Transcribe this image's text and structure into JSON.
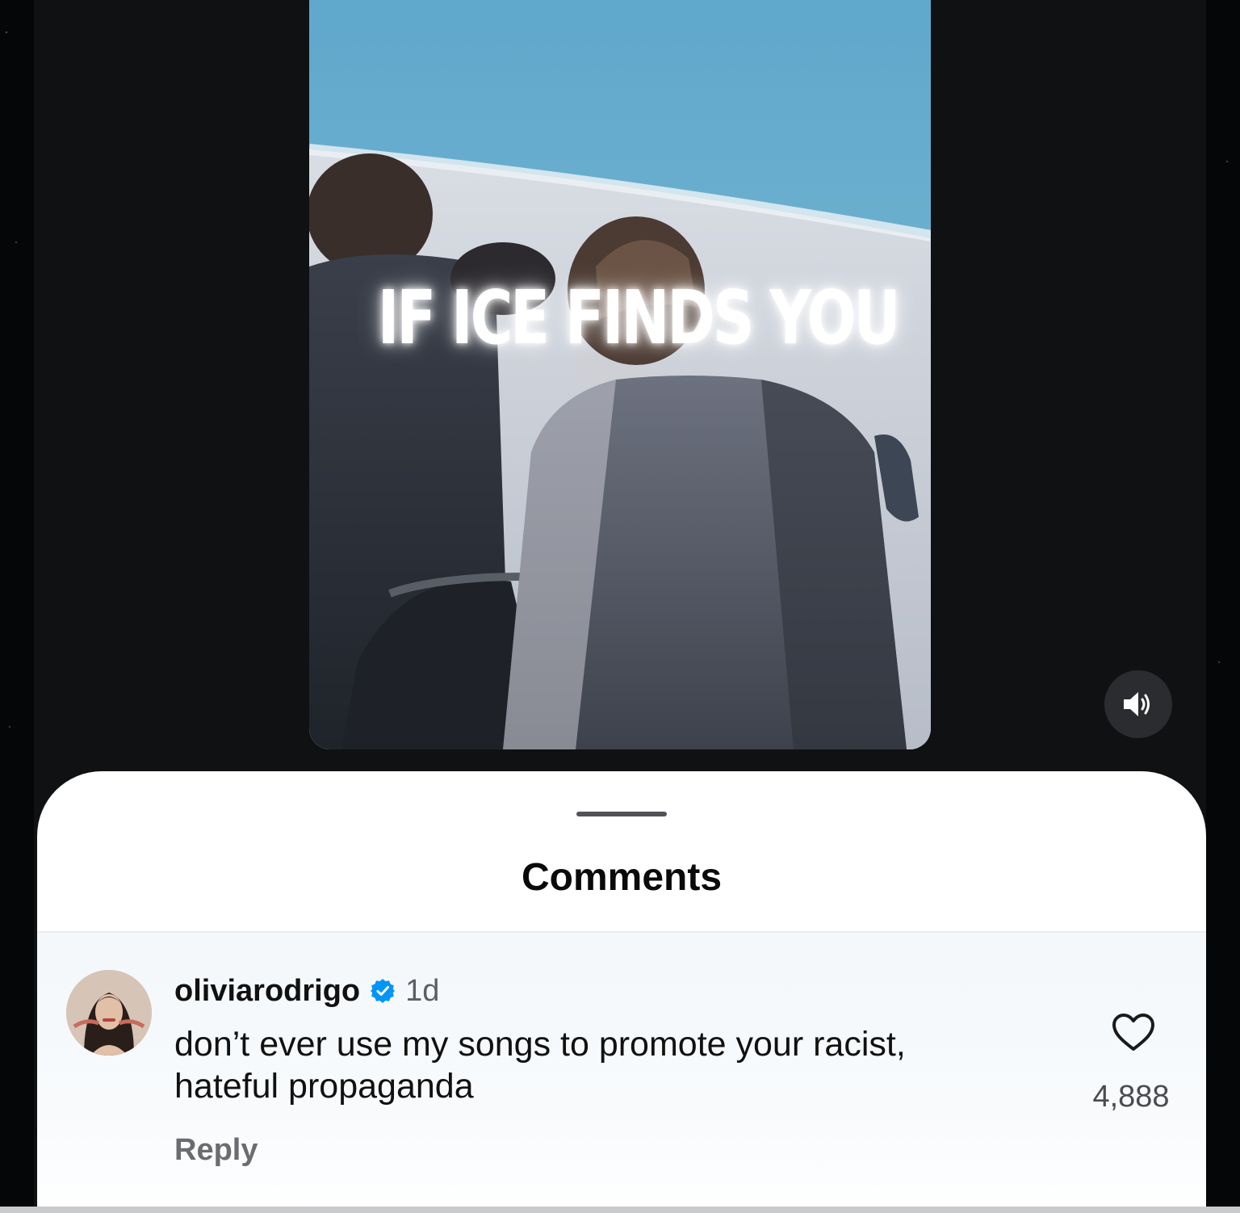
{
  "video": {
    "overlay_text": "IF ICE FINDS YOU",
    "sound_icon": "speaker-on-icon"
  },
  "comments_sheet": {
    "title": "Comments",
    "comment": {
      "username": "oliviarodrigo",
      "verified_icon": "verified-badge-icon",
      "timestamp": "1d",
      "text": "don’t ever use my songs to promote your racist, hateful propaganda",
      "reply_label": "Reply",
      "like_icon": "heart-outline-icon",
      "like_count": "4,888"
    }
  },
  "colors": {
    "verified_blue": "#0095f6",
    "sheet_background": "#ffffff",
    "app_background": "#101113"
  }
}
